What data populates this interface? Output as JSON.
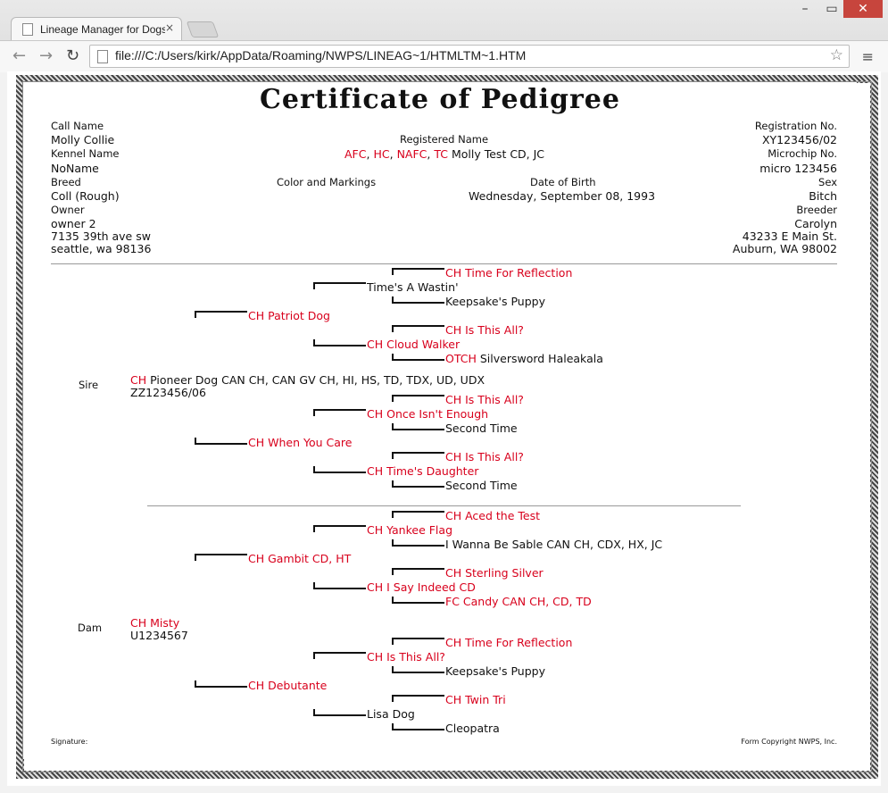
{
  "browser": {
    "tab_title": "Lineage Manager for Dogs",
    "tab_close": "×",
    "url": "file:///C:/Users/kirk/AppData/Roaming/NWPS/LINEAG~1/HTMLTM~1.HTM",
    "win_min": "–",
    "win_max": "▭",
    "win_close": "✕",
    "back": "←",
    "forward": "→",
    "reload": "↻",
    "star": "☆",
    "menu": "≡"
  },
  "certificate": {
    "title": "Certificate of Pedigree",
    "call_name_label": "Call Name",
    "call_name": "Molly Collie",
    "kennel_name_label": "Kennel Name",
    "kennel_name": "NoName",
    "breed_label": "Breed",
    "breed": "Coll (Rough)",
    "owner_label": "Owner",
    "owner_name": "owner 2",
    "owner_addr1": "7135 39th ave sw",
    "owner_addr2": "seattle, wa 98136",
    "registered_name_label": "Registered Name",
    "reg_title1": "AFC",
    "reg_sep1": ",",
    "reg_title2": "HC",
    "reg_sep2": ",",
    "reg_title3": "NAFC",
    "reg_sep3": ",",
    "reg_title4": "TC",
    "reg_name_rest": "Molly Test CD, JC",
    "color_label": "Color and Markings",
    "dob_label": "Date of Birth",
    "dob": "Wednesday, September 08, 1993",
    "registration_label": "Registration No.",
    "registration": "XY123456/02",
    "microchip_label": "Microchip No.",
    "microchip": "micro 123456",
    "sex_label": "Sex",
    "sex": "Bitch",
    "breeder_label": "Breeder",
    "breeder_name": "Carolyn",
    "breeder_addr1": "43233 E Main St.",
    "breeder_addr2": "Auburn, WA 98002",
    "signature_label": "Signature:",
    "copyright": "Form Copyright NWPS, Inc."
  },
  "pedigree": {
    "sire_label": "Sire",
    "sire_title": "CH",
    "sire_name": "Pioneer Dog CAN CH, CAN GV CH, HI, HS, TD, TDX, UD, UDX",
    "sire_reg": "ZZ123456/06",
    "dam_label": "Dam",
    "dam_name": "CH Misty",
    "dam_reg": "U1234567",
    "gen2": {
      "ss": "CH Patriot Dog",
      "sd": "CH When You Care",
      "ds": "CH Gambit CD, HT",
      "dd": "CH Debutante"
    },
    "gen3": {
      "sss": "Time's A Wastin'",
      "ssd": "CH Cloud Walker",
      "sds": "CH Once Isn't Enough",
      "sdd": "CH Time's Daughter",
      "dss": "CH Yankee Flag",
      "dsd": "CH I Say Indeed CD",
      "dds": "CH Is This All?",
      "ddd": "Lisa Dog"
    },
    "gen4": {
      "a1": "CH Time For Reflection",
      "a2": "Keepsake's Puppy",
      "a3": "CH Is This All?",
      "a4_title": "OTCH",
      "a4_name": "Silversword Haleakala",
      "a5": "CH Is This All?",
      "a6": "Second Time",
      "a7": "CH Is This All?",
      "a8": "Second Time",
      "b1": "CH Aced the Test",
      "b2": "I Wanna Be Sable CAN CH, CDX, HX, JC",
      "b3": "CH Sterling Silver",
      "b4": "FC Candy CAN CH, CD, TD",
      "b5": "CH Time For Reflection",
      "b6": "Keepsake's Puppy",
      "b7": "CH Twin Tri",
      "b8": "Cleopatra"
    }
  },
  "colors": {
    "title_red": "#d8001c",
    "close_red": "#c7453d"
  }
}
